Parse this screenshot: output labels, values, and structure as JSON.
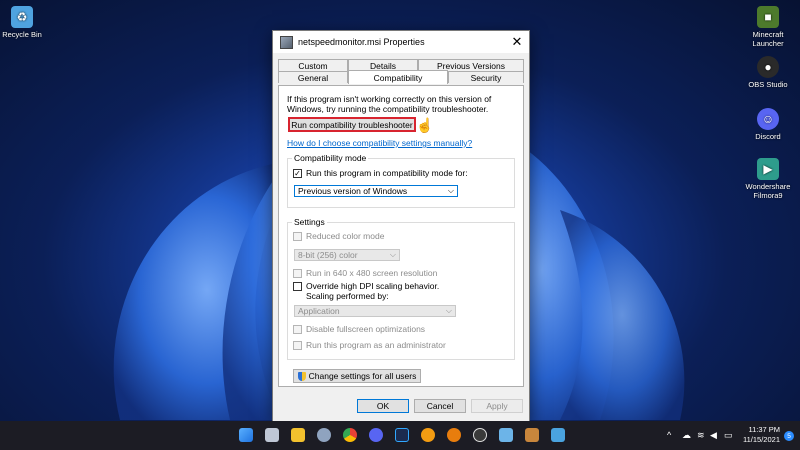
{
  "desktop": {
    "icons": [
      {
        "label": "Recycle Bin",
        "icon": "recycle-bin-icon",
        "color": "#4fa3e0"
      },
      {
        "label": "Minecraft Launcher",
        "icon": "minecraft-icon",
        "color": "#4d7a2c"
      },
      {
        "label": "OBS Studio",
        "icon": "obs-icon",
        "color": "#2a2a2a"
      },
      {
        "label": "Discord",
        "icon": "discord-icon",
        "color": "#5865f2"
      },
      {
        "label": "Wondershare Filmora9",
        "icon": "filmora-icon",
        "color": "#2e9c8c"
      }
    ]
  },
  "dialog": {
    "title": "netspeedmonitor.msi Properties",
    "close_glyph": "✕",
    "tabs_row1": [
      "Custom",
      "Details",
      "Previous Versions"
    ],
    "tabs_row2": [
      "General",
      "Compatibility",
      "Security"
    ],
    "active_tab": "Compatibility",
    "intro": "If this program isn't working correctly on this version of Windows, try running the compatibility troubleshooter.",
    "troubleshooter_button": "Run compatibility troubleshooter",
    "help_link": "How do I choose compatibility settings manually?",
    "compat_group": {
      "label": "Compatibility mode",
      "checkbox_label": "Run this program in compatibility mode for:",
      "checked": true,
      "check_glyph": "✓",
      "selected_os": "Previous version of Windows"
    },
    "settings_group": {
      "label": "Settings",
      "reduced_color": "Reduced color mode",
      "color_option": "8-bit (256) color",
      "resolution": "Run in 640 x 480 screen resolution",
      "dpi_line1": "Override high DPI scaling behavior.",
      "dpi_line2": "Scaling performed by:",
      "dpi_option": "Application",
      "fullscreen": "Disable fullscreen optimizations",
      "admin": "Run this program as an administrator"
    },
    "change_all_button": "Change settings for all users",
    "ok_button": "OK",
    "cancel_button": "Cancel",
    "apply_button": "Apply",
    "chevron_glyph": "⌵",
    "cursor_glyph": "☝"
  },
  "taskbar": {
    "time": "11:37 PM",
    "date": "11/15/2021",
    "notification_count": "5",
    "tray_caret": "^",
    "icons": [
      {
        "name": "start-icon",
        "color": "#3a9af0"
      },
      {
        "name": "task-view-icon",
        "color": "#bfc7d5"
      },
      {
        "name": "file-explorer-icon",
        "color": "#f2c12e"
      },
      {
        "name": "settings-icon",
        "color": "#8fa3bf"
      },
      {
        "name": "chrome-icon",
        "color": "#e94235"
      },
      {
        "name": "discord-icon",
        "color": "#5865f2"
      },
      {
        "name": "photoshop-icon",
        "color": "#1b2b4f"
      },
      {
        "name": "orange-app-icon",
        "color": "#f39c12"
      },
      {
        "name": "blender-icon",
        "color": "#e87d0d"
      },
      {
        "name": "obs-icon",
        "color": "#3a3a3a"
      },
      {
        "name": "photos-icon",
        "color": "#6cb4e8"
      },
      {
        "name": "package-icon",
        "color": "#c8863c"
      },
      {
        "name": "snipping-tool-icon",
        "color": "#4aa3df"
      }
    ]
  }
}
